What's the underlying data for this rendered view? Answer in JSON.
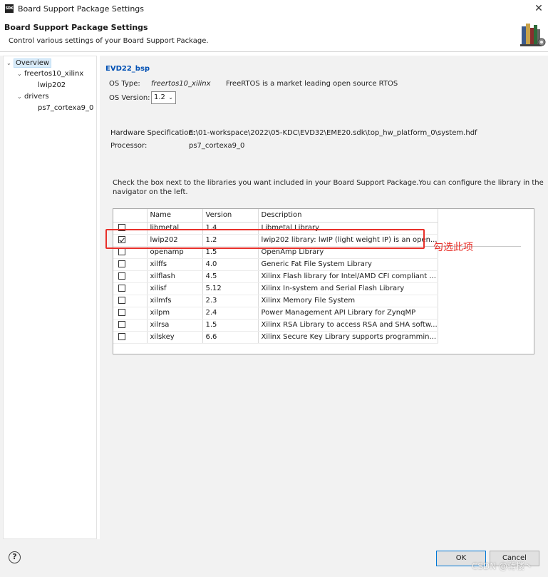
{
  "window": {
    "logo_text": "SDK",
    "title": "Board Support Package Settings",
    "close_glyph": "✕"
  },
  "header": {
    "title": "Board Support Package Settings",
    "subtitle": "Control various settings of your Board Support Package.",
    "icon": "books-icon"
  },
  "tree": {
    "items": [
      {
        "label": "Overview",
        "expanded": true,
        "selected": true
      },
      {
        "label": "freertos10_xilinx",
        "expanded": true
      },
      {
        "label": "lwip202"
      },
      {
        "label": "drivers",
        "expanded": true
      },
      {
        "label": "ps7_cortexa9_0"
      }
    ]
  },
  "overview": {
    "bsp_name": "EVD22_bsp",
    "os_type_label": "OS Type:",
    "os_type_value": "freertos10_xilinx",
    "os_description": "FreeRTOS is a market leading open source RTOS",
    "os_version_label": "OS Version:",
    "os_version_value": "1.2",
    "hw_spec_label": "Hardware Specification:",
    "hw_spec_value": "E:\\01-workspace\\2022\\05-KDC\\EVD32\\EME20.sdk\\top_hw_platform_0\\system.hdf",
    "processor_label": "Processor:",
    "processor_value": "ps7_cortexa9_0",
    "instructions_line1": "Check the box next to the libraries you want included in your Board Support Package.You can configure the library in the",
    "instructions_line2": "navigator on the left."
  },
  "libraries": {
    "columns": [
      "Name",
      "Version",
      "Description"
    ],
    "rows": [
      {
        "checked": false,
        "name": "libmetal",
        "version": "1.4",
        "description": "Libmetal Library"
      },
      {
        "checked": true,
        "name": "lwip202",
        "version": "1.2",
        "description": "lwip202 library: lwIP (light weight IP) is an open..."
      },
      {
        "checked": false,
        "name": "openamp",
        "version": "1.5",
        "description": "OpenAmp Library"
      },
      {
        "checked": false,
        "name": "xilffs",
        "version": "4.0",
        "description": "Generic Fat File System Library"
      },
      {
        "checked": false,
        "name": "xilflash",
        "version": "4.5",
        "description": "Xilinx Flash library for Intel/AMD CFI compliant ..."
      },
      {
        "checked": false,
        "name": "xilisf",
        "version": "5.12",
        "description": "Xilinx In-system and Serial Flash Library"
      },
      {
        "checked": false,
        "name": "xilmfs",
        "version": "2.3",
        "description": "Xilinx Memory File System"
      },
      {
        "checked": false,
        "name": "xilpm",
        "version": "2.4",
        "description": "Power Management API Library for ZynqMP"
      },
      {
        "checked": false,
        "name": "xilrsa",
        "version": "1.5",
        "description": "Xilinx RSA Library to access RSA and SHA softw..."
      },
      {
        "checked": false,
        "name": "xilskey",
        "version": "6.6",
        "description": "Xilinx Secure Key Library supports programmin..."
      }
    ]
  },
  "annotation": {
    "text": "勾选此项",
    "color": "#e8302a"
  },
  "footer": {
    "help_glyph": "?",
    "ok_label": "OK",
    "cancel_label": "Cancel",
    "watermark": "CSDN @蒋楼丶"
  },
  "colors": {
    "accent": "#0078d7",
    "bsp_link": "#0050b4",
    "selection": "#d9ebf9"
  }
}
